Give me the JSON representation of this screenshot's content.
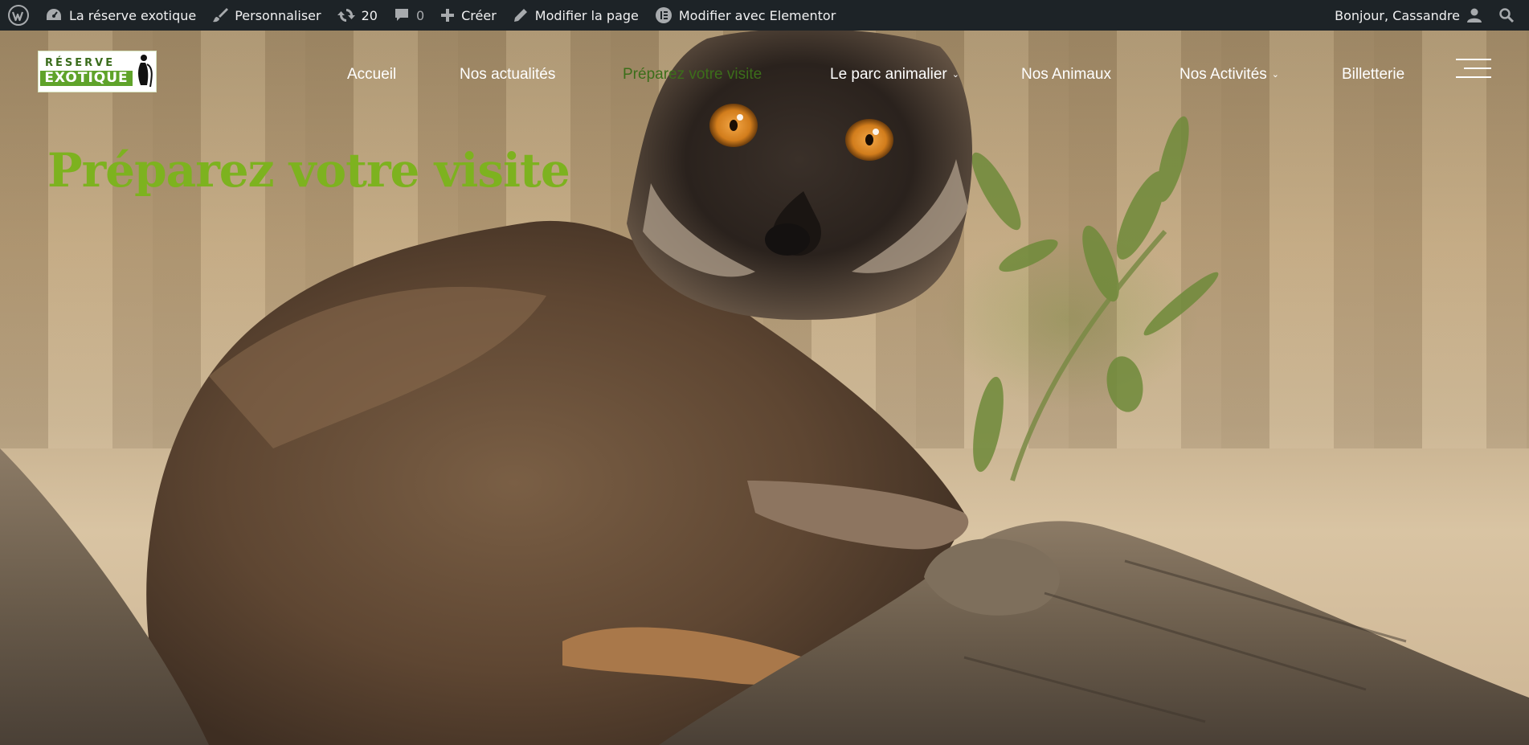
{
  "admin_bar": {
    "wp_logo_icon": "wordpress-icon",
    "site_name": "La réserve exotique",
    "customize": "Personnaliser",
    "updates_count": "20",
    "comments_count": "0",
    "new_label": "Créer",
    "edit_page": "Modifier la page",
    "edit_elementor": "Modifier avec Elementor",
    "greeting": "Bonjour, Cassandre"
  },
  "logo": {
    "line1": "RÉSERVE",
    "line2": "EXOTIQUE"
  },
  "nav": {
    "items": [
      {
        "label": "Accueil"
      },
      {
        "label": "Nos actualités"
      },
      {
        "label": "Préparez votre visite"
      },
      {
        "label": "Le parc animalier"
      },
      {
        "label": "Nos Animaux"
      },
      {
        "label": "Nos Activités"
      },
      {
        "label": "Billetterie"
      }
    ],
    "active_index": 2
  },
  "hero": {
    "title": "Préparez votre visite"
  },
  "colors": {
    "admin_bar": "#1d2327",
    "accent_green": "#7db21f",
    "active_nav_green": "#3c6e1a"
  }
}
